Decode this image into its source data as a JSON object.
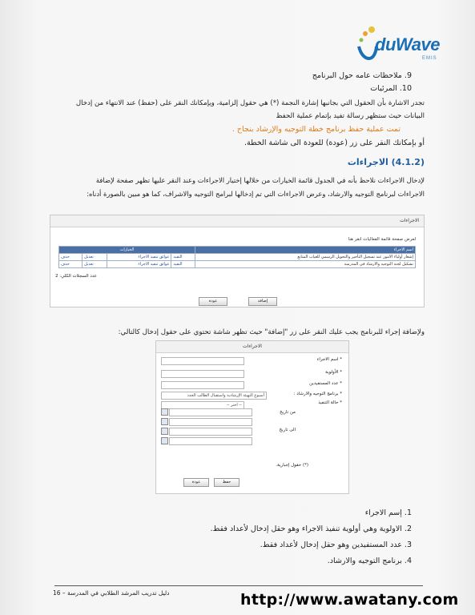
{
  "logo": {
    "brand": "duWave",
    "sub": "EMIS"
  },
  "para": {
    "item9": "9.  ملاحظات عامه حول البرنامج",
    "item10": "10.  المرئيات",
    "note1": "تجدر الاشارة بأن الحقول التي بجانبها إشارة النجمة (*) هي حقول إلزامية، ويإمكانك النقر على (حفظ) عند الانتهاء من إدخال",
    "note2": "البيانات حيث ستظهر رسالة تفيد بإتمام عملية الحفظ",
    "success": "تمت عملية حفظ برنامج خطة التوجيه والإرشاد بنجاح .",
    "back": "أو بإمكانك النقر على زر (عودة) للعودة الى شاشة الخطة."
  },
  "section": {
    "heading": "(4.1.2) الاجراءات",
    "intro1": "لإدخال الاجراءات نلاحظ بأنه في الجدول قائمة الخيارات من خلالها إختيار الاجراءات وعند النقر عليها تظهر صفحة لإضافة",
    "intro2": "الاجراءات لبرنامج التوجيه والارشاد، وعرض الاجراءات التي تم إدخالها لبرامج التوجيه والاشراف، كما هو مبين بالصورة أدناه:"
  },
  "shot1": {
    "bar": "الاجراءات",
    "subtitle": "لعرض صفحة قائمة الفعاليات  انقر هنا",
    "col_title": "اسم الاجراء",
    "header_mid": "الخيارات",
    "rows": [
      {
        "name": "إشعار أولياء الامور عند تسجيل التأخير والتحويل الرسمي للغياب المتابع",
        "opt1": "التقيد",
        "opt2": "عوائق تنفيذ الاجراء",
        "opt3": "تعديل",
        "opt4": "حذف"
      },
      {
        "name": "تشكيل لجنة التوجيه والارشاد في المدرسة",
        "opt1": "التقيد",
        "opt2": "عوائق تنفيذ الاجراء",
        "opt3": "تعديل",
        "opt4": "حذف"
      }
    ],
    "count": "عدد السجلات الكلي: 2",
    "add_btn": "إضافة",
    "back_btn": "عودة"
  },
  "mid_text": "ولإضافة إجراء للبرنامج يجب عليك النقر على زر \"إضافة\" حيث تظهر شاشة تحتوي على حقول إدخال كالتالي:",
  "shot2": {
    "bar": "الاجراءات",
    "labels": {
      "name": "* اسم الاجراء",
      "priority": "* الأولوية",
      "beneficiaries": "* عدد المستفيدين",
      "program": "* برنامج التوجيه والارشاد :",
      "status": "* حالة التنفيذ",
      "from": "من تاريخ",
      "to": "الى تاريخ",
      "required": "(*) حقول إجبارية."
    },
    "program_value": "أسبوع التهيئة الإرشادية واستقبال الطالب الجدد",
    "status_value": "-- اختر --",
    "save_btn": "حفظ",
    "back_btn": "عودة"
  },
  "list": [
    "1.  إسم الاجراء",
    "2.  الاولوية وهي أولوية تنفيذ الاجراء وهو حقل إدخال لأعداد فقط.",
    "3.  عدد المستفيدين وهو حقل إدخال لأعداد فقط.",
    "4.  برنامج التوجيه والارشاد."
  ],
  "footer": "دليل تدريب المرشد الطلابي في المدرسة – 16",
  "watermark": "http://www.awatany.com",
  "colors": {
    "accent": "#1f5c9e",
    "success": "#e07b1a",
    "logo": "#1b6fb5"
  }
}
